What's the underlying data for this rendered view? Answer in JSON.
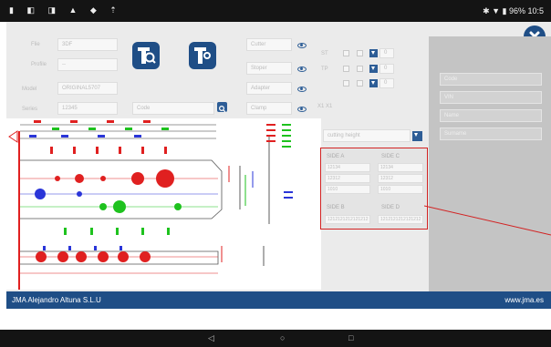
{
  "status_bar": {
    "left_icons": "▮ ◧ ◨ ▲ ◆ ⇡",
    "right": "✱ ▼ ▮ 96% 10:5"
  },
  "form": {
    "flie_label": "Flie",
    "flie_value": "3DF",
    "profile_label": "Profile",
    "profile_value": "--",
    "model_label": "Model",
    "model_value": "ORIGINAL5707",
    "series_label": "Series",
    "series_value": "12345",
    "code_label": "Code",
    "cutter_label": "Cutter",
    "stopper_label": "Stoper",
    "adapter_label": "Adapter",
    "clamp_label": "Clamp",
    "st_label": "ST",
    "tp_label": "TP",
    "t1_value": "0",
    "t2_value": "0",
    "t3_value": "0",
    "coord": "X1 X1",
    "cutting_height": "cutting height"
  },
  "right_panel": {
    "code": "Code",
    "vin": "VIN",
    "name": "Name",
    "surname": "Surname"
  },
  "sides": {
    "side_a": "SIDE A",
    "side_c": "SIDE C",
    "side_b": "SIDE B",
    "side_d": "SIDE D",
    "a1": "12134",
    "a2": "12312",
    "a3": "1010",
    "c1": "12134",
    "c2": "12312",
    "c3": "1010",
    "b1": "1212121212121212",
    "d1": "1212121212121212"
  },
  "footer": {
    "company": "JMA Alejandro Altuna S.L.U",
    "url": "www.jma.es"
  },
  "navbar": {
    "back": "◁",
    "home": "○",
    "recent": "□"
  },
  "colors": {
    "accent": "#1f4e86",
    "highlight": "#d22222",
    "cut_red": "#e02020",
    "cut_blue": "#2a35d8",
    "cut_green": "#1ec21e"
  }
}
